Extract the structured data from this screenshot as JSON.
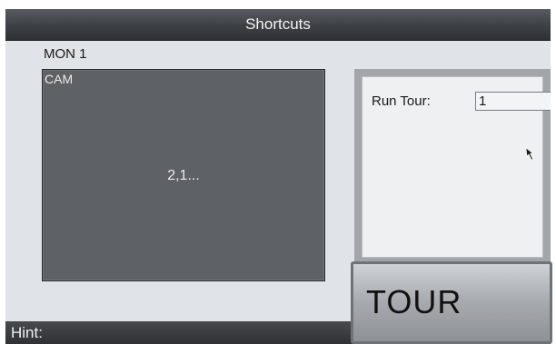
{
  "window": {
    "title": "Shortcuts"
  },
  "monitor": {
    "label": "MON 1"
  },
  "camera": {
    "label": "CAM",
    "value": "2,1..."
  },
  "tour": {
    "run_label": "Run Tour:",
    "run_value": "1",
    "button_label": "TOUR"
  },
  "hint": {
    "label": "Hint:"
  },
  "icons": {
    "cursor": "mouse-pointer-icon"
  }
}
